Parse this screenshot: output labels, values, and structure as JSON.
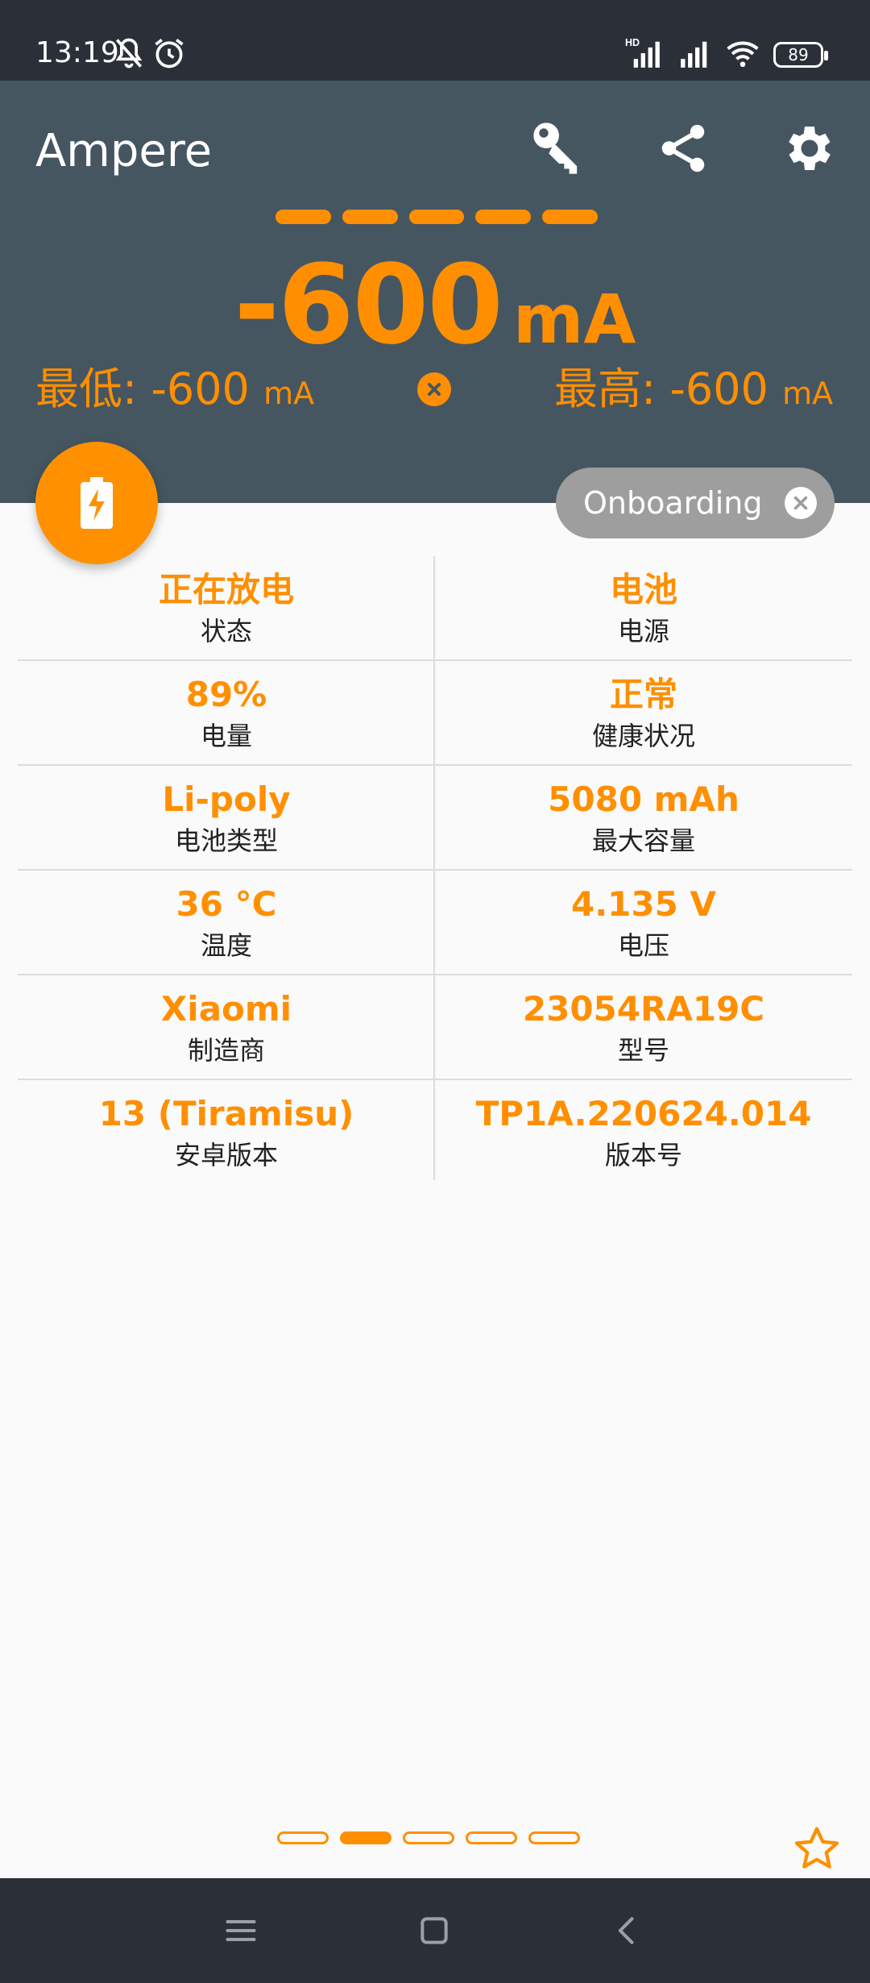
{
  "status_bar": {
    "time": "13:19",
    "battery_level": "89",
    "icons": [
      "mute-icon",
      "alarm-icon",
      "hd-signal-icon",
      "signal-icon",
      "wifi-icon",
      "battery-icon"
    ]
  },
  "header": {
    "app_title": "Ampere",
    "actions": [
      "key-icon",
      "share-icon",
      "settings-icon"
    ]
  },
  "current": {
    "value": "-600",
    "unit": "mA",
    "min_label": "最低: -600",
    "max_label": "最高: -600",
    "min_unit": "mA",
    "max_unit": "mA"
  },
  "chip": {
    "label": "Onboarding"
  },
  "info_rows": [
    [
      {
        "value": "正在放电",
        "label": "状态"
      },
      {
        "value": "电池",
        "label": "电源"
      }
    ],
    [
      {
        "value": "89%",
        "label": "电量"
      },
      {
        "value": "正常",
        "label": "健康状况"
      }
    ],
    [
      {
        "value": "Li-poly",
        "label": "电池类型"
      },
      {
        "value": "5080 mAh",
        "label": "最大容量"
      }
    ],
    [
      {
        "value": "36 °C",
        "label": "温度"
      },
      {
        "value": "4.135 V",
        "label": "电压"
      }
    ],
    [
      {
        "value": "Xiaomi",
        "label": "制造商"
      },
      {
        "value": "23054RA19C",
        "label": "型号"
      }
    ],
    [
      {
        "value": "13 (Tiramisu)",
        "label": "安卓版本"
      },
      {
        "value": "TP1A.220624.014",
        "label": "版本号"
      }
    ]
  ],
  "pager": {
    "count": 5,
    "active_index": 1
  },
  "colors": {
    "accent": "#ff8f00",
    "header_bg": "#455661",
    "status_bg": "#2b3038",
    "chip_bg": "#9e9e9e",
    "background": "#fafafa"
  }
}
